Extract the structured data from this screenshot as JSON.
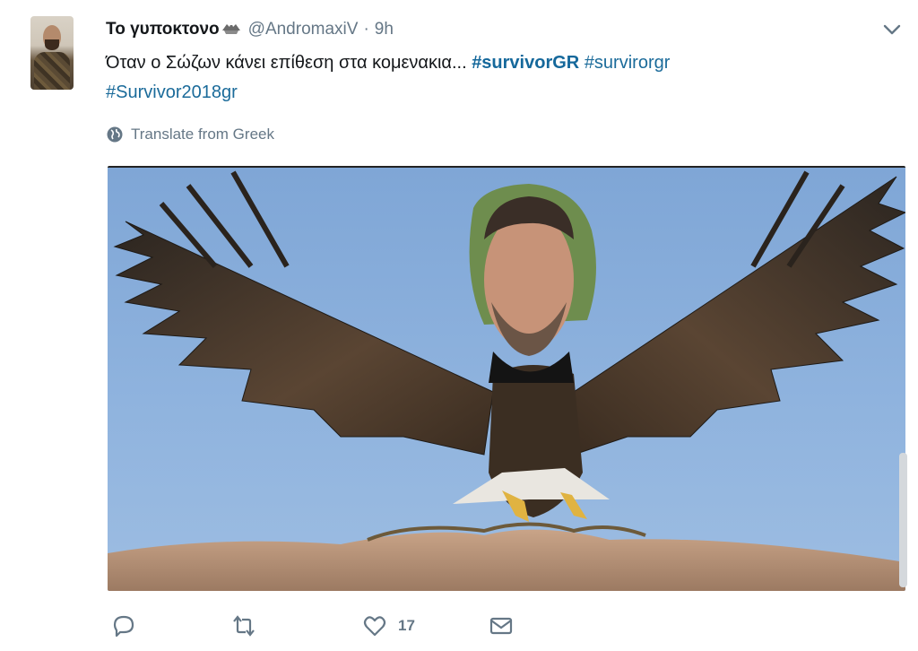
{
  "tweet": {
    "display_name": "Το γυποκτονο",
    "handle": "@AndromaxiV",
    "separator": "·",
    "time": "9h",
    "text_plain": "Όταν ο Σώζων κάνει επίθεση στα κομενακια... ",
    "hashtags": [
      "#survivorGR",
      "#survirorgr",
      "#Survivor2018gr"
    ],
    "translate_label": "Translate from Greek"
  },
  "icons": {
    "badge": "eagle-emoji-icon",
    "caret": "chevron-down-icon",
    "translate": "globe-icon",
    "reply": "reply-icon",
    "retweet": "retweet-icon",
    "like": "heart-icon",
    "dm": "envelope-icon"
  },
  "actions": {
    "reply_count": "",
    "retweet_count": "",
    "like_count": "17"
  },
  "colors": {
    "hashtag": "#1b6b9a",
    "text": "#14171a",
    "muted": "#657786",
    "sky": "#8fb3de"
  }
}
